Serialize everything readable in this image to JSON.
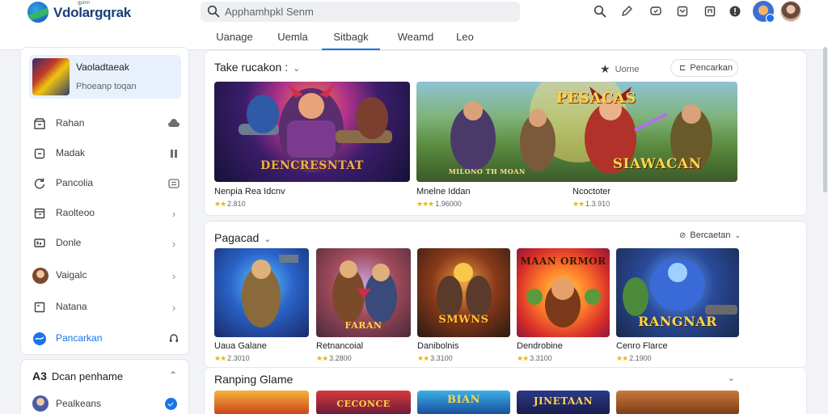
{
  "header": {
    "app_title": "Vdolargqrak",
    "app_subtitle": "gpmn",
    "search_placeholder": "Apphamhpkl Senm",
    "icons": [
      "search-icon",
      "pen-icon",
      "chat-icon",
      "inbox-icon",
      "bookmark-icon",
      "notification-icon",
      "badge-avatar",
      "user-avatar"
    ]
  },
  "tabs": [
    {
      "label": "Uanage",
      "active": false
    },
    {
      "label": "Uemla",
      "active": false
    },
    {
      "label": "Sitbagk",
      "active": true
    },
    {
      "label": "Weamd",
      "active": false
    },
    {
      "label": "Leo",
      "active": false
    }
  ],
  "sidebar": {
    "profile": {
      "name": "Vaoladtaeak",
      "subtitle": "Phoeanp toqan"
    },
    "items": [
      {
        "label": "Rahan",
        "icon": "store-icon",
        "right_icon": "cloud-icon"
      },
      {
        "label": "Madak",
        "icon": "square-icon",
        "right_icon": "pause-icon"
      },
      {
        "label": "Pancolia",
        "icon": "refresh-icon",
        "right_icon": "list-icon"
      },
      {
        "label": "Raolteoo",
        "icon": "panel-icon",
        "right_icon": "chevron-right-icon"
      },
      {
        "label": "Donle",
        "icon": "monitor-icon",
        "right_icon": "chevron-right-icon"
      },
      {
        "label": "Vaigalc",
        "icon": "avatar",
        "right_icon": "chevron-right-icon"
      },
      {
        "label": "Natana",
        "icon": "window-icon",
        "right_icon": "chevron-right-icon"
      },
      {
        "label": "Pancarkan",
        "icon": "globe-icon",
        "right_icon": "support-icon",
        "active": true
      }
    ],
    "section2": {
      "prefix": "A3",
      "title": "Dcan penhame",
      "item_label": "Pealkeans"
    }
  },
  "section1": {
    "title": "Take rucakon :",
    "side_label": "Uorne",
    "pill_label": "Pencarkan",
    "cards": [
      {
        "title": "Nenpia Rea Idcnv",
        "rating": "2.810"
      },
      {
        "title": "Mnelne Iddan",
        "rating": "1.96000"
      },
      {
        "title": "Ncoctoter",
        "rating": "1.3.910"
      }
    ],
    "banners": [
      "DENCRESNTAT",
      "PESACAS",
      "SIAWACAN",
      "MILONO TH MOAN"
    ]
  },
  "section2": {
    "title": "Pagacad",
    "pill_label": "Bercaetan",
    "cards": [
      {
        "title": "Uaua Galane",
        "rating": "2.3010"
      },
      {
        "title": "Retnancoial",
        "rating": "3.2800"
      },
      {
        "title": "Danibolnis",
        "rating": "3.3100"
      },
      {
        "title": "Dendrobine",
        "rating": "3.3100"
      },
      {
        "title": "Cenro Flarce",
        "rating": "2.1900"
      }
    ],
    "banners": [
      "FARAN",
      "SMWNS",
      "MAAN ORMOR",
      "RANGNAR"
    ]
  },
  "section3": {
    "title": "Ranping Glame",
    "banners": [
      "",
      "CECONCE",
      "BIAN",
      "JINETAAN",
      ""
    ]
  }
}
